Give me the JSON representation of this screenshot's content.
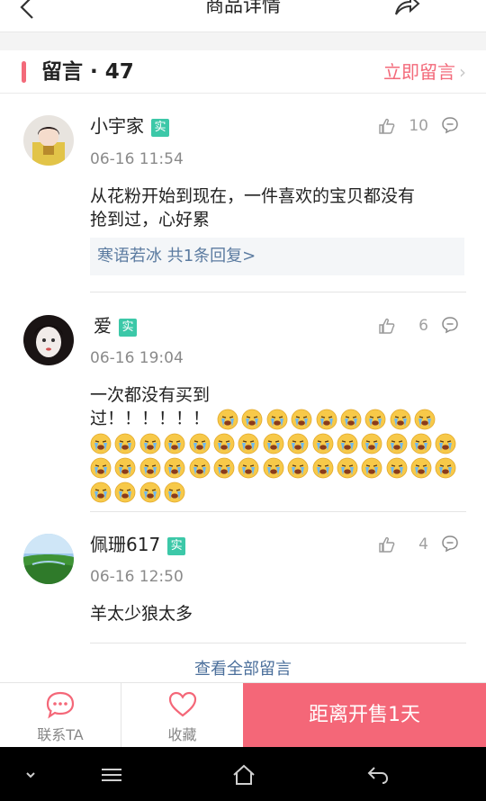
{
  "header": {
    "title": "商品详情",
    "back_icon": "chevron-left-icon",
    "share_icon": "share-icon",
    "more_icon": "more-icon",
    "more_label": "•••"
  },
  "section": {
    "title": "留言 · 47",
    "action_label": "立即留言",
    "action_chevron": "›",
    "accent_color": "#f36a7a"
  },
  "comments": [
    {
      "username": "小宇家",
      "badge": "实",
      "time": "06-16 11:54",
      "likes": "10",
      "text_lines": [
        "从花粉开始到现在，一件喜欢的宝贝都没有",
        "抢到过，心好累"
      ],
      "reply_summary": "寒语若冰 共1条回复>"
    },
    {
      "username": "爱",
      "badge": "实",
      "time": "06-16 19:04",
      "likes": "6",
      "text_lines": [
        "一次都没有买到",
        "过！！！！！！"
      ],
      "emoji": "crying-face-emoji"
    },
    {
      "username": "佩珊617",
      "badge": "实",
      "time": "06-16 12:50",
      "likes": "4",
      "text_lines": [
        "羊太少狼太多"
      ]
    }
  ],
  "view_all_label": "查看全部留言",
  "bottom_bar": {
    "contact_label": "联系TA",
    "favorite_label": "收藏",
    "cta_label": "距离开售1天",
    "cta_color": "#f46778"
  },
  "system_nav": {
    "icons": [
      "chevron-down-icon",
      "menu-icon",
      "home-icon",
      "back-arrow-icon"
    ]
  }
}
